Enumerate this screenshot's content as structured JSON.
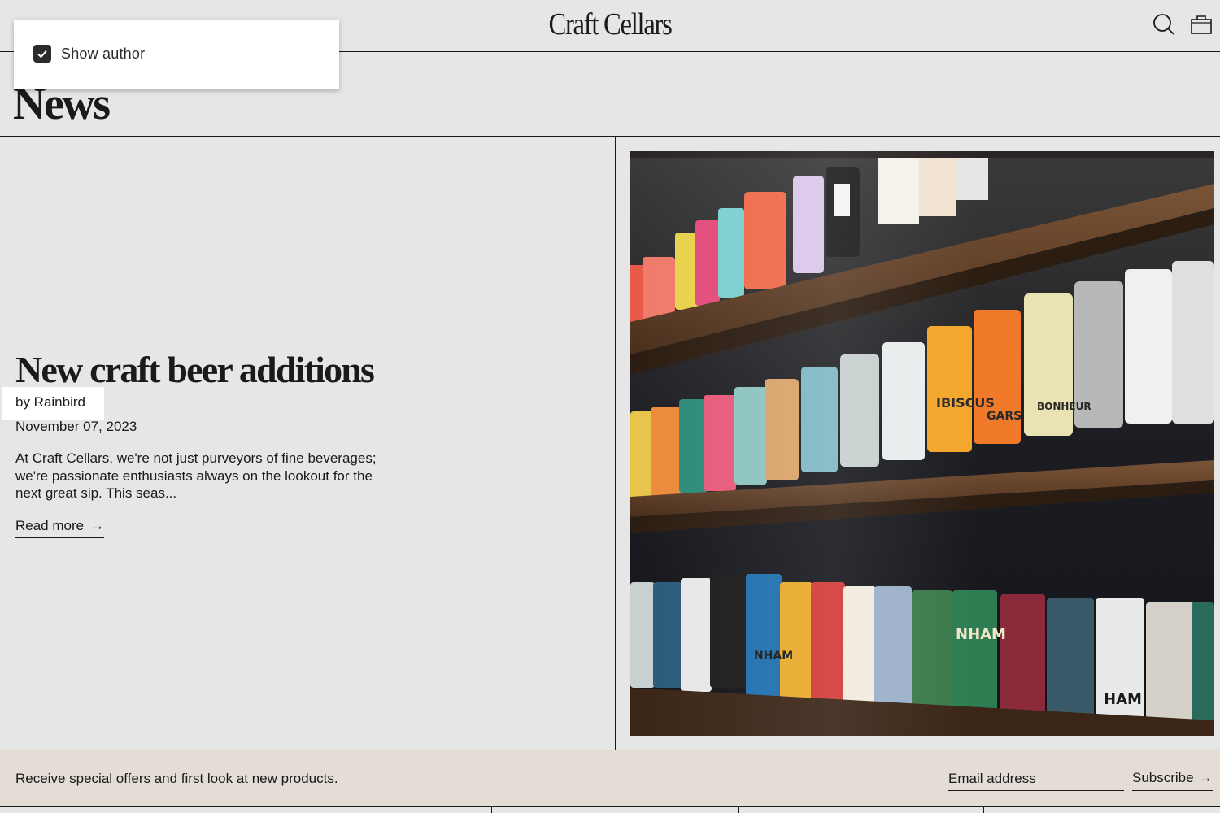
{
  "header": {
    "logo": "Craft Cellars",
    "search_icon": "search-icon",
    "cart_icon": "shopping-bag-icon"
  },
  "popover": {
    "checkbox_label": "Show author",
    "checked": true
  },
  "page": {
    "title": "News"
  },
  "article": {
    "title": "New craft beer additions",
    "author": "by Rainbird",
    "date": "November 07, 2023",
    "excerpt": "At Craft Cellars, we're not just purveyors of fine beverages; we're passionate enthusiasts always on the lookout for the next great sip. This seas...",
    "read_more": "Read more",
    "read_more_arrow": "→",
    "image_icon": "craft-beer-cans-shelf-photo"
  },
  "newsletter": {
    "text": "Receive special offers and first look at new products.",
    "email_placeholder": "Email address",
    "subscribe_label": "Subscribe",
    "subscribe_arrow": "→"
  },
  "colors": {
    "background": "#e6e6e6",
    "text": "#1a1a1a",
    "newsletter_bg": "#e4ddd6",
    "popover_bg": "#ffffff"
  }
}
